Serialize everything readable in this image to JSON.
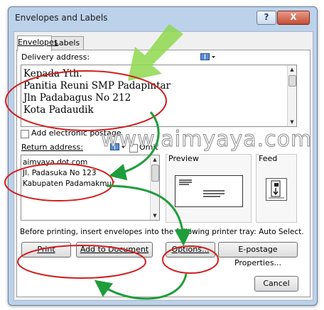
{
  "dialog": {
    "title": "Envelopes and Labels"
  },
  "titlebar": {
    "help_label": "?",
    "close_label": "X"
  },
  "tabs": [
    {
      "label": "Envelopes"
    },
    {
      "label": "Labels"
    }
  ],
  "delivery": {
    "label": "Delivery address:",
    "lines": [
      "Kepada Yth.",
      "Panitia Reuni SMP Padapintar",
      "Jln Padabagus No 212",
      "Kota Padaudik"
    ]
  },
  "electronic_postage": {
    "label": "Add electronic postage",
    "checked": false
  },
  "return": {
    "label": "Return address:",
    "omit_label": "Omit",
    "omit_checked": false,
    "lines": [
      "aimyaya dot com",
      "Jl. Padasuka No 123",
      "Kabupaten Padamakmur"
    ]
  },
  "preview": {
    "label": "Preview"
  },
  "feed": {
    "label": "Feed"
  },
  "printer_note": "Before printing, insert envelopes into the following printer tray: Auto Select.",
  "buttons": {
    "print": "Print",
    "add_to_document": "Add to Document",
    "options": "Options...",
    "e_postage": "E-postage Properties...",
    "cancel": "Cancel"
  },
  "watermark": "www.aimyaya.com",
  "annotation_colors": {
    "circle": "#d11f1f",
    "arrow": "#1e9d3a",
    "big_arrow": "#8ed84f"
  }
}
